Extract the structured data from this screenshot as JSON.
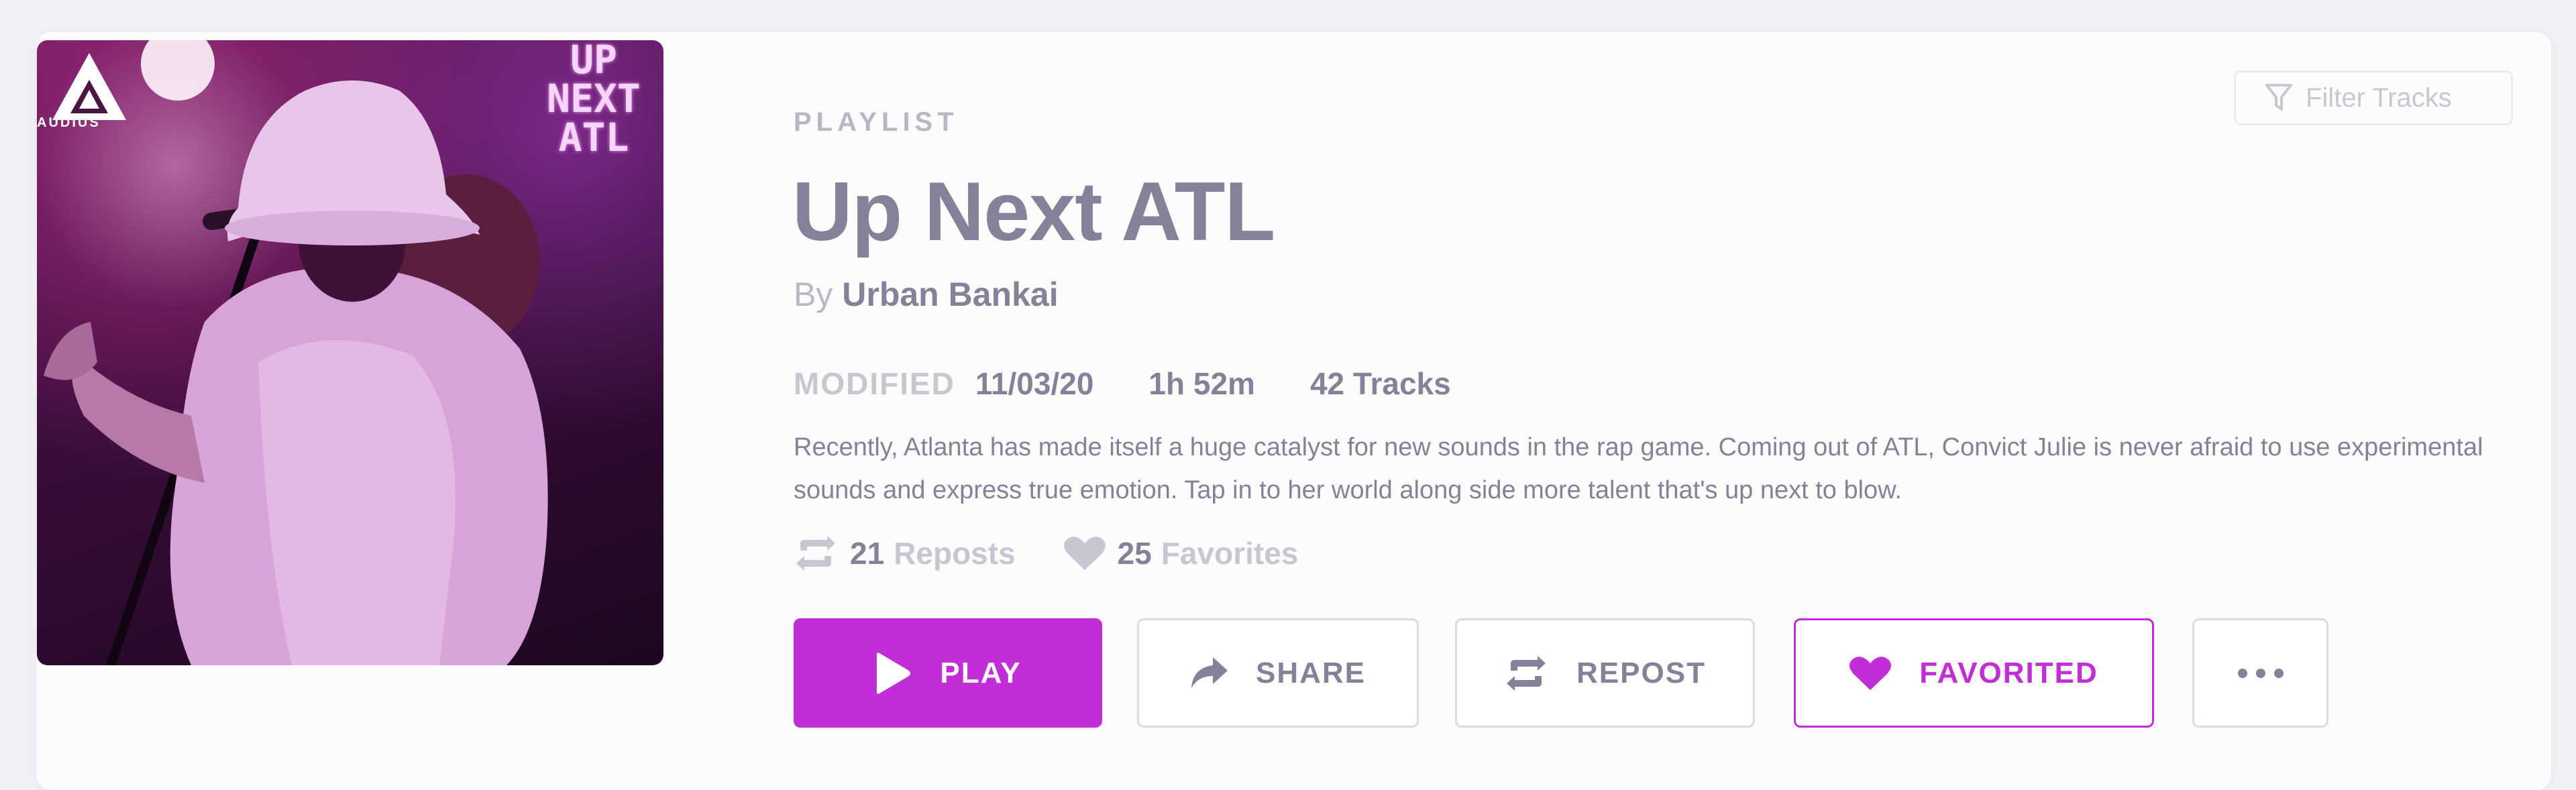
{
  "artwork": {
    "logo_text": "AUDIUS",
    "overlay_lines": [
      "UP",
      "NEXT",
      "ATL"
    ]
  },
  "playlist": {
    "type_label": "PLAYLIST",
    "title": "Up Next ATL",
    "by_label": "By",
    "author": "Urban Bankai",
    "modified_label": "MODIFIED",
    "modified_date": "11/03/20",
    "duration": "1h 52m",
    "track_count": "42 Tracks",
    "description": "Recently, Atlanta has made itself a huge catalyst for new sounds in the rap game. Coming out of ATL, Convict Julie is never afraid to use experimental sounds and express true emotion. Tap in to her world along side more talent that's up next to blow."
  },
  "stats": {
    "reposts_count": "21",
    "reposts_label": "Reposts",
    "favorites_count": "25",
    "favorites_label": "Favorites"
  },
  "actions": {
    "play_label": "PLAY",
    "share_label": "SHARE",
    "repost_label": "REPOST",
    "favorited_label": "FAVORITED"
  },
  "filter": {
    "placeholder": "Filter Tracks"
  },
  "icons": {
    "play": "play-icon",
    "share": "share-arrow-icon",
    "repost": "repost-icon",
    "heart": "heart-icon",
    "more": "more-dots-icon",
    "filter": "filter-funnel-icon"
  },
  "colors": {
    "accent": "#c12ed8",
    "text_primary": "#858199",
    "text_muted": "#c8c6d0"
  }
}
